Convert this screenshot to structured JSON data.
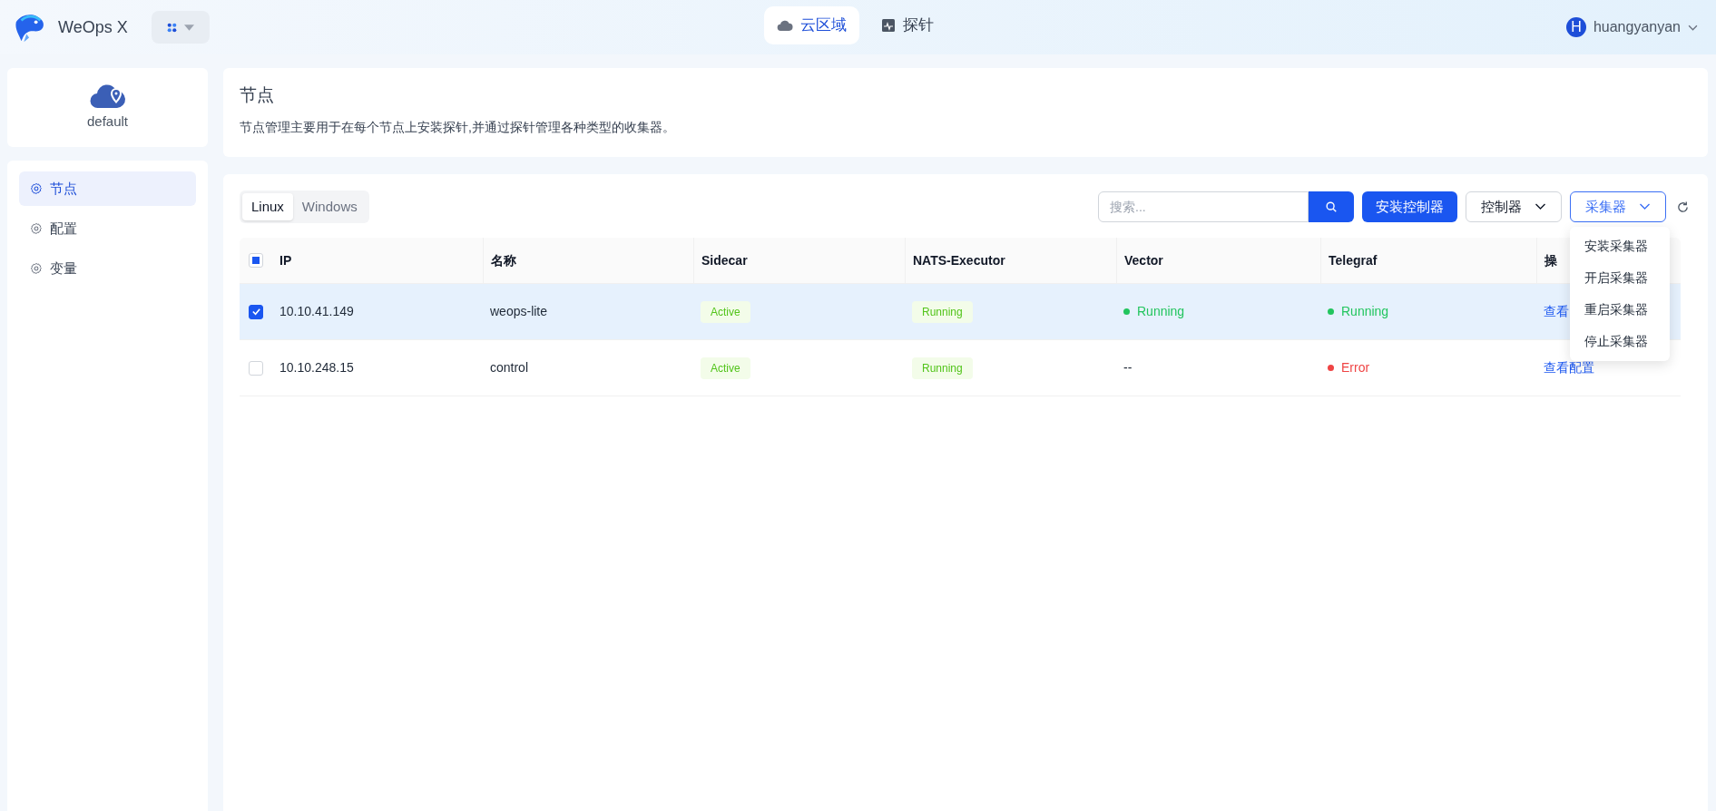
{
  "app": {
    "title": "WeOps X"
  },
  "top_nav": [
    {
      "label": "云区域",
      "selected": true
    },
    {
      "label": "探针",
      "selected": false
    }
  ],
  "user": {
    "avatar": "H",
    "name": "huangyanyan"
  },
  "sidebar": {
    "area": "default",
    "items": [
      {
        "label": "节点",
        "selected": true
      },
      {
        "label": "配置",
        "selected": false
      },
      {
        "label": "变量",
        "selected": false
      }
    ]
  },
  "page": {
    "title": "节点",
    "description": "节点管理主要用于在每个节点上安装探针,并通过探针管理各种类型的收集器。"
  },
  "os_tabs": [
    {
      "label": "Linux",
      "selected": true
    },
    {
      "label": "Windows",
      "selected": false
    }
  ],
  "toolbar": {
    "search": {
      "placeholder": "搜索..."
    },
    "install_button": "安装控制器",
    "controller_menu": {
      "label": "控制器",
      "open": false
    },
    "collector_menu": {
      "label": "采集器",
      "open": true,
      "items": [
        "安装采集器",
        "开启采集器",
        "重启采集器",
        "停止采集器"
      ]
    }
  },
  "table": {
    "select_all": {
      "indeterminate": true
    },
    "columns": [
      "IP",
      "名称",
      "Sidecar",
      "NATS-Executor",
      "Vector",
      "Telegraf",
      "操"
    ],
    "rows": [
      {
        "selected": true,
        "checked": true,
        "cells": [
          {
            "kind": "text",
            "text": "10.10.41.149"
          },
          {
            "kind": "text",
            "text": "weops-lite"
          },
          {
            "kind": "tag",
            "text": "Active"
          },
          {
            "kind": "tag",
            "text": "Running"
          },
          {
            "kind": "dot",
            "text": "Running",
            "color": "#22c55e"
          },
          {
            "kind": "dot",
            "text": "Running",
            "color": "#22c55e"
          },
          {
            "kind": "link",
            "text": "查看"
          }
        ]
      },
      {
        "selected": false,
        "checked": false,
        "cells": [
          {
            "kind": "text",
            "text": "10.10.248.15"
          },
          {
            "kind": "text",
            "text": "control"
          },
          {
            "kind": "tag",
            "text": "Active"
          },
          {
            "kind": "tag",
            "text": "Running"
          },
          {
            "kind": "text",
            "text": "--"
          },
          {
            "kind": "dot",
            "text": "Error",
            "color": "#ef4444"
          },
          {
            "kind": "link",
            "text": "查看配置"
          }
        ]
      }
    ]
  }
}
